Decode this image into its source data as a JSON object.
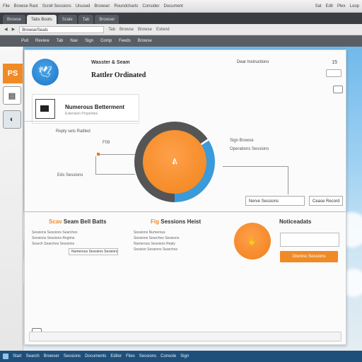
{
  "os_menu": {
    "items": [
      "File",
      "Browse Rast",
      "Scroll Sessions",
      "Unused",
      "Browser",
      "Roundcharts",
      "Consider",
      "Document",
      "Edit",
      "Document"
    ],
    "right": [
      "Sat",
      "Edit",
      "Plex",
      "Loop"
    ]
  },
  "browser": {
    "tabs": [
      "Browse",
      "Tabs Boots",
      "Scale",
      "Tab",
      "Browser"
    ],
    "url": "Browse/Seals",
    "nav_items": [
      "Tab",
      "Browse",
      "Browse",
      "Extend"
    ],
    "bookmarks": [
      "Pull",
      "Review",
      "Tab",
      "Nav",
      "Sign",
      "Comp",
      "Feeds",
      "Browse"
    ]
  },
  "dock": {
    "tile1": "PS"
  },
  "window": {
    "title": "Wasster & Seam",
    "subtitle": "Rattler Ordinated",
    "title_right": "Dear Instructions",
    "number": "15"
  },
  "panel": {
    "title": "Numerous Betterment",
    "subtitle": "Extension Properties"
  },
  "chart_labels": {
    "left_top": "Reply sets Rattled",
    "left_mid": "F09",
    "left_bottom": "Eds Sessions",
    "right_top": "Sign Browse",
    "right_sub": "Operations Sessions",
    "donut_center": "ᕕ"
  },
  "right_boxes": {
    "box1": "Nerve Sessions",
    "box2": "Cease Record"
  },
  "columns": [
    {
      "head_a": "Scav",
      "head_b": "Seam Bell Batts",
      "lines": [
        "Sessions Sessions Searches",
        "Sessions Sessions Regime",
        "Search Searches Sessions",
        "Numerous Sessions Sessions"
      ]
    },
    {
      "head_a": "Fig",
      "head_b": "Sessions Heist",
      "lines": [
        "Sessions Numerous",
        "Sessions Searches Sessions",
        "Numerous Sessions Reply",
        "Session Sessions Searches"
      ]
    }
  ],
  "notifications": {
    "title": "Noticeadats",
    "button": "Dismiss Sessions"
  },
  "taskbar": {
    "items": [
      "Start",
      "Search",
      "Browser",
      "Sessions",
      "Documents",
      "Editor",
      "Files",
      "Sessions",
      "Console",
      "Sign"
    ]
  }
}
